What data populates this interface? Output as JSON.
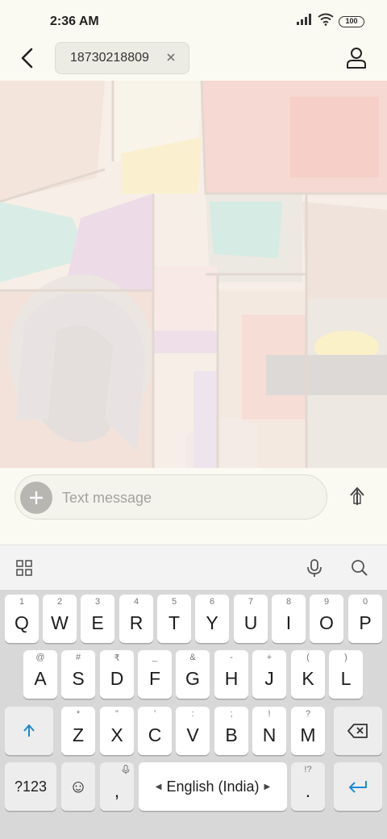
{
  "status_bar": {
    "time": "2:36 AM",
    "battery": "100",
    "icons": [
      "signal-icon",
      "wifi-icon",
      "battery-icon"
    ]
  },
  "header": {
    "recipient": "18730218809",
    "icons": [
      "back-arrow-icon",
      "close-icon",
      "person-icon"
    ]
  },
  "compose": {
    "placeholder": "Text message",
    "icons": [
      "plus-icon",
      "send-arrow-icon"
    ]
  },
  "keyboard_toolbar": {
    "icons": [
      "apps-grid-icon",
      "microphone-icon",
      "search-icon"
    ]
  },
  "keyboard": {
    "row1": [
      {
        "hint": "1",
        "label": "Q"
      },
      {
        "hint": "2",
        "label": "W"
      },
      {
        "hint": "3",
        "label": "E"
      },
      {
        "hint": "4",
        "label": "R"
      },
      {
        "hint": "5",
        "label": "T"
      },
      {
        "hint": "6",
        "label": "Y"
      },
      {
        "hint": "7",
        "label": "U"
      },
      {
        "hint": "8",
        "label": "I"
      },
      {
        "hint": "9",
        "label": "O"
      },
      {
        "hint": "0",
        "label": "P"
      }
    ],
    "row2": [
      {
        "hint": "@",
        "label": "A"
      },
      {
        "hint": "#",
        "label": "S"
      },
      {
        "hint": "₹",
        "label": "D"
      },
      {
        "hint": "_",
        "label": "F"
      },
      {
        "hint": "&",
        "label": "G"
      },
      {
        "hint": "-",
        "label": "H"
      },
      {
        "hint": "+",
        "label": "J"
      },
      {
        "hint": "(",
        "label": "K"
      },
      {
        "hint": ")",
        "label": "L"
      }
    ],
    "row3": [
      {
        "hint": "*",
        "label": "Z"
      },
      {
        "hint": "\"",
        "label": "X"
      },
      {
        "hint": "'",
        "label": "C"
      },
      {
        "hint": ":",
        "label": "V"
      },
      {
        "hint": ";",
        "label": "B"
      },
      {
        "hint": "!",
        "label": "N"
      },
      {
        "hint": "?",
        "label": "M"
      }
    ],
    "symbols_key": "?123",
    "emoji_key": "☺",
    "comma_key": ",",
    "space_label": "English (India)",
    "period_key": ".",
    "period_hint": "!?",
    "icons": [
      "shift-icon",
      "backspace-icon",
      "enter-icon",
      "microphone-small-icon"
    ]
  },
  "colors": {
    "accent": "#1a8ad4",
    "background": "#fbfaf2",
    "keyboard_bg": "#d8d8d8"
  }
}
